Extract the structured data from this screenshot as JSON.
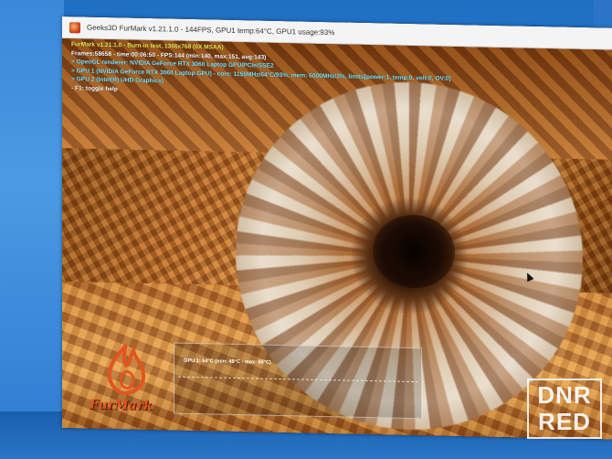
{
  "window": {
    "title": "Geeks3D FurMark v1.21.1.0 - 144FPS, GPU1 temp:64°C, GPU1 usage:93%"
  },
  "overlay": {
    "lines": [
      "FurMark v1.21.1.0 - Burn-in test, 1366x768 (0X MSAA)",
      "Frames:58658 - time:00:06:50 - FPS:144 (min:140, max:151, avg:143)",
      "> OpenGL renderer: NVIDIA GeForce RTX 3060 Laptop GPU/PCIe/SSE2",
      "> GPU 1 (NVIDIA GeForce RTX 3060 Laptop GPU) - core: 1155MHz/64°C/93%, mem: 6000MHz/3%, limits[power:1, temp:0, volt:0, OV:0]",
      "> GPU 2 (Intel(R) UHD Graphics)",
      "- F1: toggle help"
    ]
  },
  "temp_graph": {
    "label": "GPU 1: 64°C (min: 49°C - max: 65°C)"
  },
  "logo": {
    "text": "FurMark"
  },
  "watermark": {
    "line1": "DNR",
    "line2": "RED"
  },
  "colors": {
    "overlay_title": "#f4f05a",
    "overlay_stats": "#ffffff",
    "overlay_renderer": "#7ee8ff",
    "logo": "#e2551f"
  },
  "icons": {
    "app_icon": "furmark-flame-icon",
    "cursor": "mouse-pointer-icon"
  }
}
